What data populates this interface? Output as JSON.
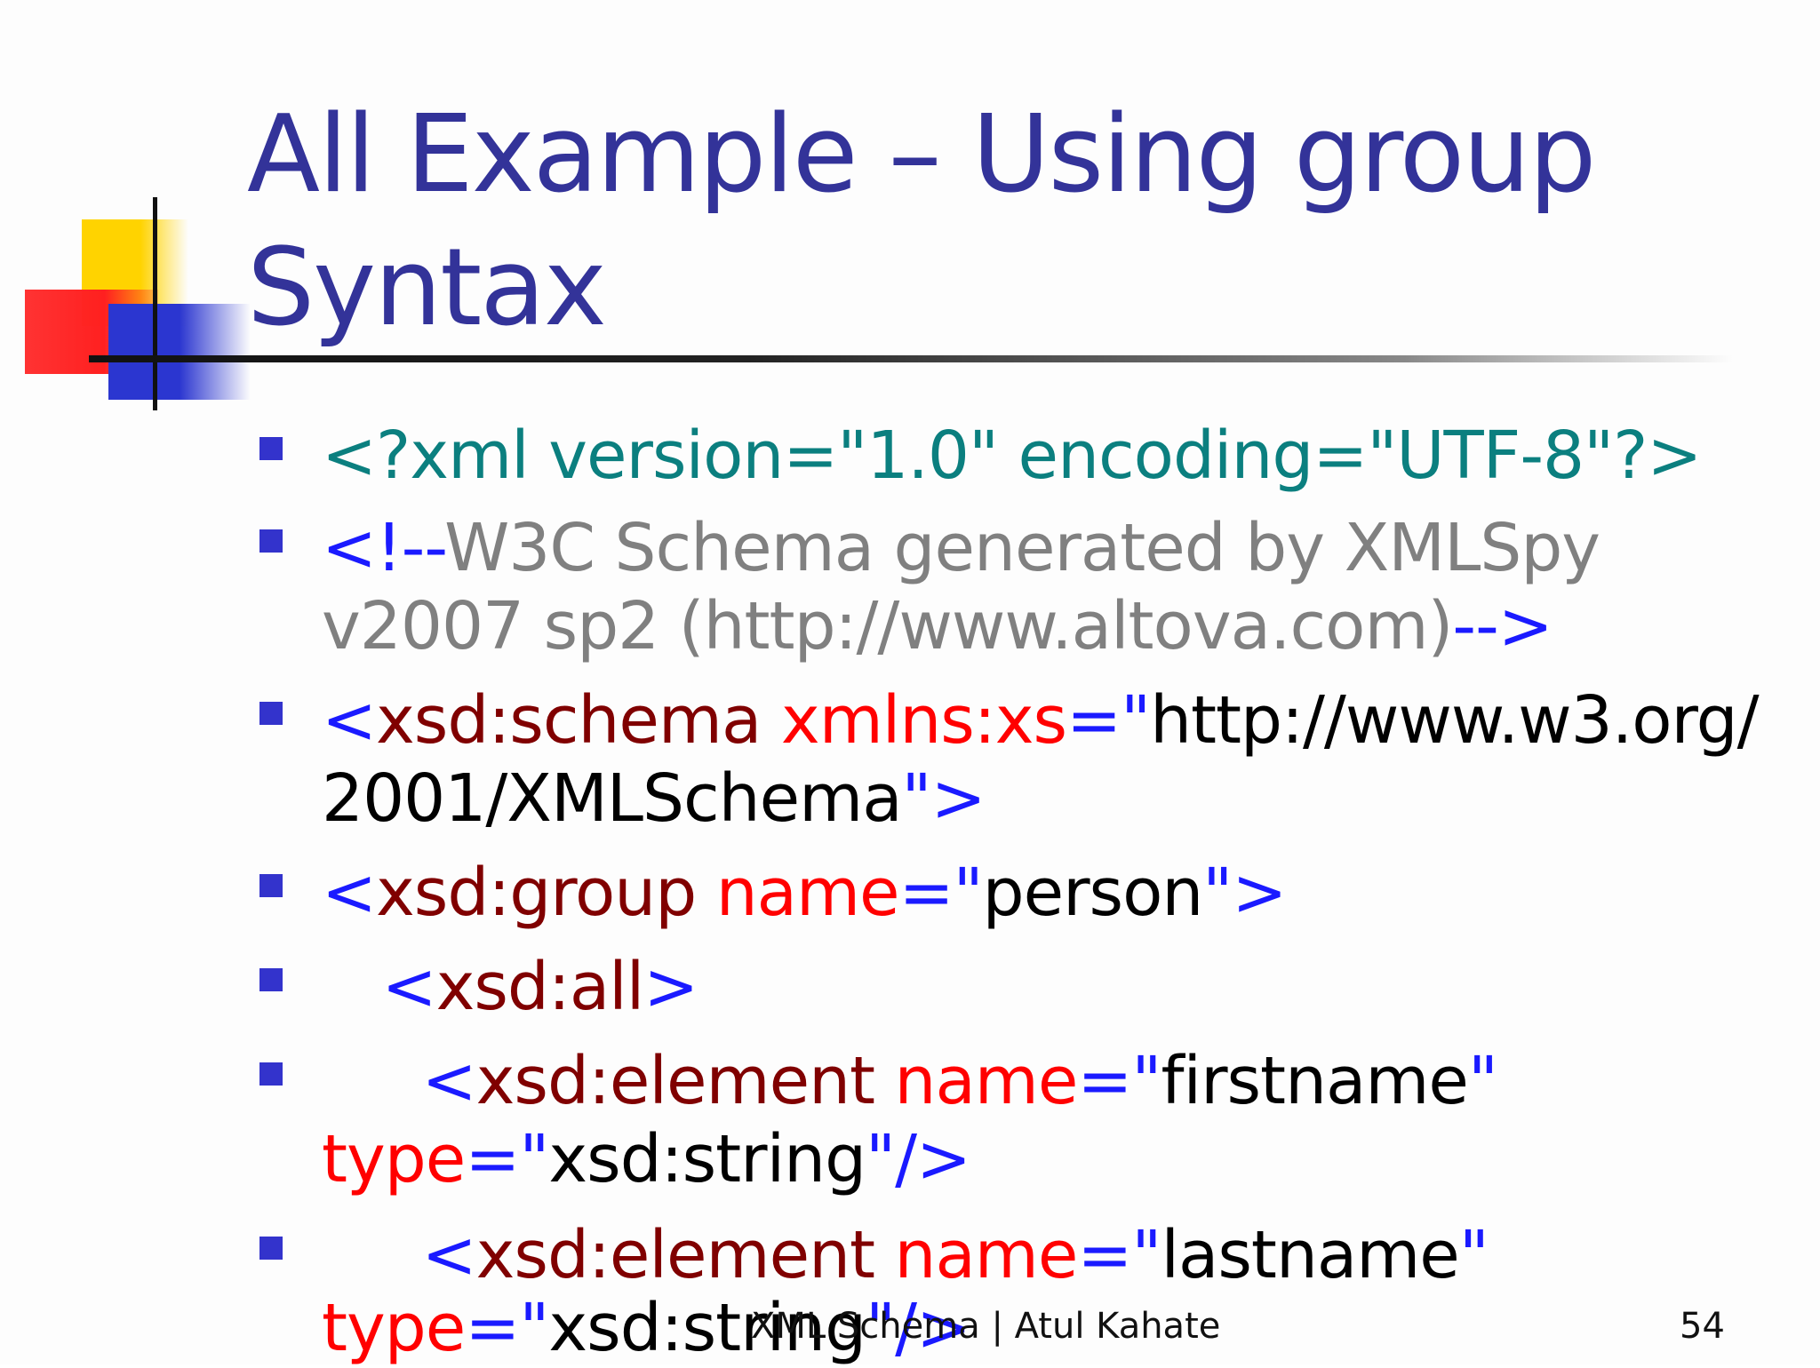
{
  "title": {
    "line1": "All Example – Using group",
    "line2": "Syntax"
  },
  "colors": {
    "title": "#333399",
    "bullet": "#3333cc",
    "teal": "#0b7f7f",
    "tag_bracket": "#1a1aff",
    "tag_name": "#800000",
    "attribute": "#ff0000",
    "comment": "#808080",
    "value": "#000000"
  },
  "bullets": [
    {
      "l1": {
        "a": "<?xml version=\"1.0\" encoding=\"UTF-8\"?>"
      }
    },
    {
      "l1": {
        "a": "<!--",
        "b": "W3C Schema generated by XMLSpy"
      },
      "l2": {
        "a": "v2007 sp2 (http://www.altova.com)",
        "b": "-->"
      }
    },
    {
      "l1": {
        "a": "<",
        "b": "xsd:schema",
        "c": " xmlns:xs",
        "d": "=\"",
        "e": "http://www.w3.org/"
      },
      "l2": {
        "a": "2001/XMLSchema",
        "b": "\">"
      }
    },
    {
      "l1": {
        "a": "<",
        "b": "xsd:group",
        "c": " name",
        "d": "=\"",
        "e": "person",
        "f": "\">"
      }
    },
    {
      "l1": {
        "a": "   <",
        "b": "xsd:all",
        "c": ">"
      }
    },
    {
      "l1": {
        "a": "     <",
        "b": "xsd:element",
        "c": " name",
        "d": "=\"",
        "e": "firstname",
        "f": "\""
      },
      "l2": {
        "a": "type",
        "b": "=\"",
        "c": "xsd:string",
        "d": "\"/>"
      }
    },
    {
      "l1": {
        "a": "     <",
        "b": "xsd:element",
        "c": " name",
        "d": "=\"",
        "e": "lastname",
        "f": "\""
      },
      "l2": {
        "a": "type",
        "b": "=\"",
        "c": "xsd:string",
        "d": "\"/>"
      }
    }
  ],
  "footer": {
    "text": "XML Schema | Atul Kahate",
    "page": "54"
  }
}
